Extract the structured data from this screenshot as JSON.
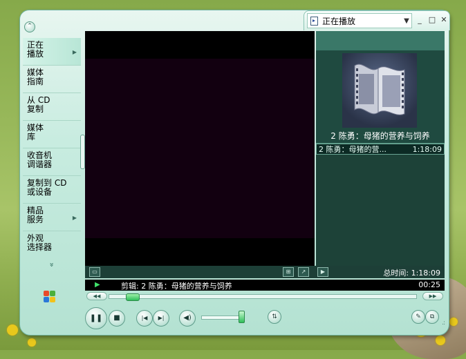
{
  "window": {
    "tab_label": "正在播放",
    "minimize": "_",
    "maximize": "□",
    "close": "✕"
  },
  "nav": {
    "items": [
      {
        "label": "正在\n播放",
        "has_arrow": true,
        "active": true
      },
      {
        "label": "媒体\n指南",
        "has_arrow": false
      },
      {
        "label": "从 CD\n复制",
        "has_arrow": false
      },
      {
        "label": "媒体\n库",
        "has_arrow": false
      },
      {
        "label": "收音机\n调谐器",
        "has_arrow": false
      },
      {
        "label": "复制到 CD\n或设备",
        "has_arrow": false
      },
      {
        "label": "精品\n服务",
        "has_arrow": true
      },
      {
        "label": "外观\n选择器",
        "has_arrow": false
      }
    ],
    "more": "»"
  },
  "now_playing": {
    "title": "2 陈勇：母猪的营养与饲养"
  },
  "playlist": {
    "items": [
      {
        "title": "2 陈勇：母猪的营...",
        "duration": "1:18:09"
      }
    ]
  },
  "strip": {
    "total_time": "总时间: 1:18:09"
  },
  "status": {
    "clip": "剪辑: 2 陈勇：母猪的营养与饲养",
    "elapsed": "00:25"
  },
  "playback": {
    "progress_fraction": 0.053,
    "volume_fraction": 0.95
  },
  "icons": {
    "play_indicator": "▶",
    "pause": "❚❚",
    "stop": "■",
    "previous": "|◀",
    "next": "▶|",
    "mute": "🔈",
    "rewind": "◀◀",
    "fast_forward": "▶▶",
    "eq": "⇅"
  }
}
